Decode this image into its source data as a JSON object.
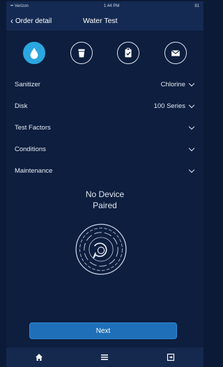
{
  "status_bar": {
    "carrier": "•• Verizon",
    "time": "1:44 PM",
    "battery": "81"
  },
  "nav": {
    "back_label": "Order detail",
    "title": "Water Test"
  },
  "top_icons": [
    {
      "icon": "water-drop-icon",
      "active": true
    },
    {
      "icon": "bucket-icon",
      "active": false
    },
    {
      "icon": "clipboard-icon",
      "active": false
    },
    {
      "icon": "mail-icon",
      "active": false
    }
  ],
  "rows": [
    {
      "label": "Sanitizer",
      "value": "Chlorine"
    },
    {
      "label": "Disk",
      "value": "100 Series"
    },
    {
      "label": "Test Factors",
      "value": ""
    },
    {
      "label": "Conditions",
      "value": ""
    },
    {
      "label": "Maintenance",
      "value": ""
    }
  ],
  "device_status": {
    "line1": "No Device",
    "line2": "Paired"
  },
  "next_label": "Next",
  "tabs": [
    "home-icon",
    "menu-icon",
    "logout-icon"
  ],
  "colors": {
    "background": "#0d1e3e",
    "accent": "#2aa6e0",
    "button": "#1f6fb8"
  }
}
